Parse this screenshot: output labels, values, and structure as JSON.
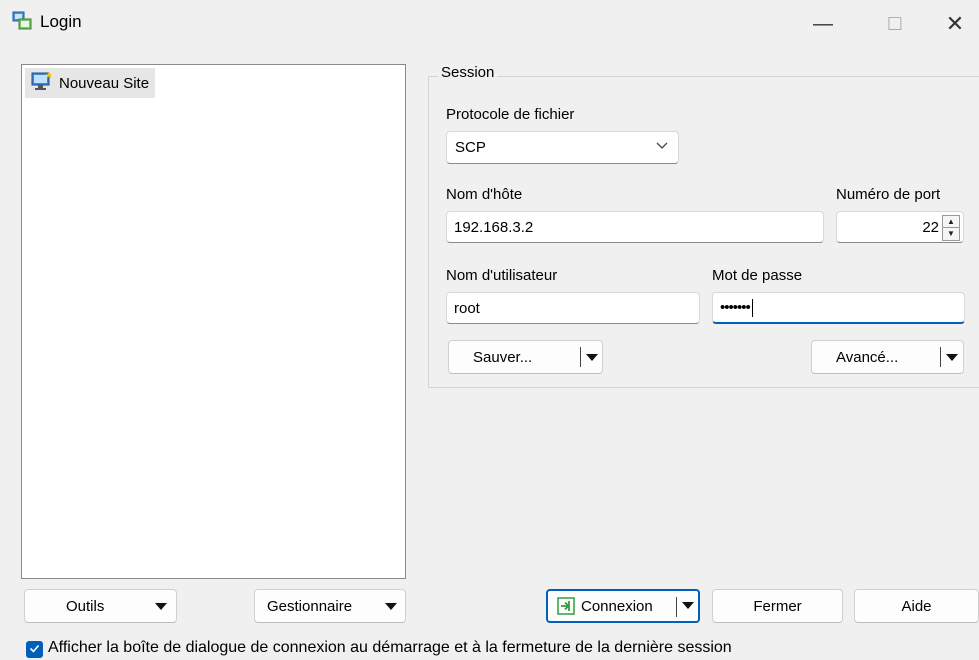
{
  "window": {
    "title": "Login",
    "icon": "winscp-login-icon",
    "controls": {
      "minimize": "—",
      "maximize": "☐",
      "close": "✕"
    }
  },
  "sites": {
    "items": [
      {
        "label": "Nouveau Site",
        "icon": "new-site-icon"
      }
    ]
  },
  "session": {
    "legend": "Session",
    "protocol_label": "Protocole de fichier",
    "protocol_value": "SCP",
    "host_label": "Nom d'hôte",
    "host_value": "192.168.3.2",
    "port_label": "Numéro de port",
    "port_value": "22",
    "user_label": "Nom d'utilisateur",
    "user_value": "root",
    "password_label": "Mot de passe",
    "password_masked": "•••••••",
    "save_label": "Sauver...",
    "advanced_label": "Avancé..."
  },
  "bottom": {
    "tools_label": "Outils",
    "manager_label": "Gestionnaire",
    "connect_label": "Connexion",
    "close_label": "Fermer",
    "help_label": "Aide"
  },
  "checkbox": {
    "checked": true,
    "label": "Afficher la boîte de dialogue de connexion au démarrage et à la fermeture de la dernière session"
  },
  "colors": {
    "accent": "#005fb8",
    "background": "#f0f0f0",
    "connect_icon": "#2e9e3e"
  }
}
